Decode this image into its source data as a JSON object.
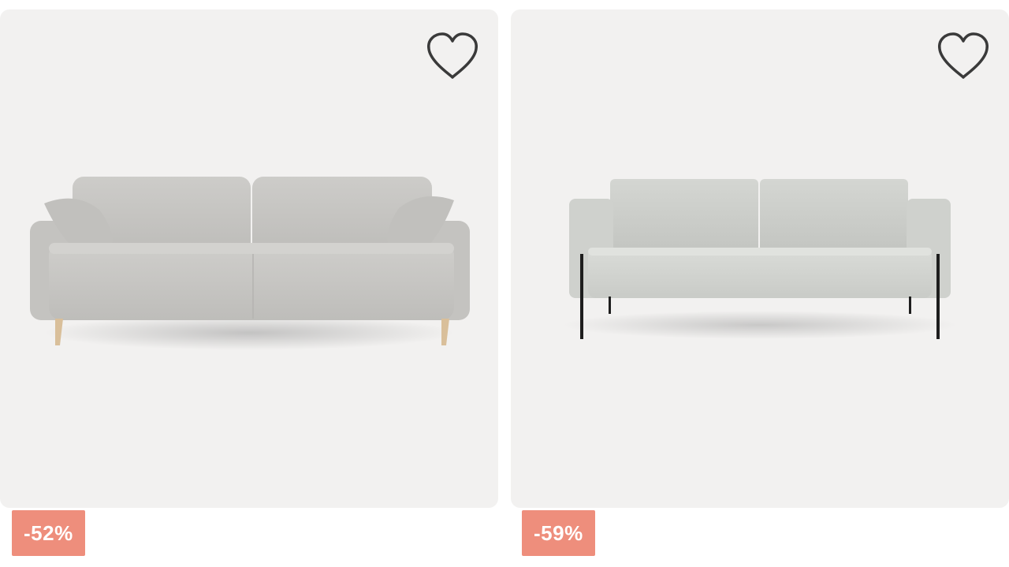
{
  "products": [
    {
      "discount": "-52%",
      "icon": "heart-outline-icon",
      "sofa_color": "#c9c8c5",
      "leg_color": "#d9bf9a"
    },
    {
      "discount": "-59%",
      "icon": "heart-outline-icon",
      "sofa_color": "#cfd1cd",
      "leg_color": "#1e1e1e"
    }
  ],
  "colors": {
    "card_bg": "#f2f1f0",
    "badge_bg": "#ee8e7c",
    "heart_stroke": "#3a3a3a"
  }
}
